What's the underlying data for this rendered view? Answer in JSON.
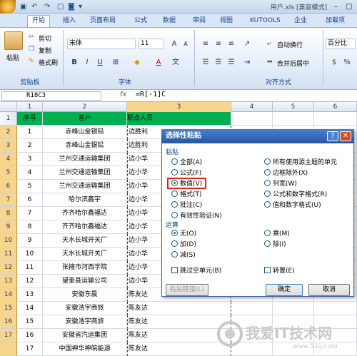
{
  "titlebar": {
    "title": "用户.xls [兼容模式]"
  },
  "tabs": [
    "开始",
    "插入",
    "页面布局",
    "公式",
    "数据",
    "审阅",
    "视图",
    "KUTOOLS",
    "企业",
    "加载项"
  ],
  "ribbon": {
    "paste_label": "粘贴",
    "cut_label": "剪切",
    "copy_label": "复制",
    "format_painter_label": "格式刷",
    "clipboard_label": "剪贴板",
    "font_name": "宋体",
    "font_size": "11",
    "font_group_label": "字体",
    "bold": "B",
    "italic": "I",
    "underline": "U",
    "wrap_text_label": "自动换行",
    "merge_label": "合并后居中",
    "align_group_label": "对齐方式",
    "number_format": "百分比"
  },
  "formula_bar": {
    "name_box": "R18C3",
    "fx": "fx",
    "formula": "=R[-1]C"
  },
  "grid": {
    "col_headers": [
      "1",
      "2",
      "3",
      "4",
      "5",
      "6"
    ],
    "row_headers": [
      "1",
      "2",
      "3",
      "4",
      "5",
      "6",
      "7",
      "8",
      "9",
      "10",
      "11",
      "12",
      "13",
      "14",
      "15",
      "16",
      "17"
    ],
    "header_row": [
      "序号",
      "客户",
      "联点人员"
    ],
    "rows": [
      [
        "1",
        "赤峰山金银铅",
        "边胜利"
      ],
      [
        "2",
        "赤峰山金银铅",
        "边胜利"
      ],
      [
        "3",
        "兰州交通运输集团",
        "边小华"
      ],
      [
        "4",
        "兰州交通运输集团",
        "边小华"
      ],
      [
        "5",
        "兰州交通运输集团",
        "边小华"
      ],
      [
        "6",
        "哈尔滨鑫宇",
        "边小华"
      ],
      [
        "7",
        "齐齐哈尔鑫福达",
        "边小华"
      ],
      [
        "8",
        "齐齐哈尔鑫福达",
        "边小华"
      ],
      [
        "9",
        "天水长城开关厂",
        "边小华"
      ],
      [
        "10",
        "天水长城开关厂",
        "边小华"
      ],
      [
        "11",
        "张掖市河西学院",
        "边小华"
      ],
      [
        "12",
        "望奎县运输公司",
        "边小华"
      ],
      [
        "13",
        "安徽东晨",
        "陈友达"
      ],
      [
        "14",
        "安徽浩宇商旅",
        "陈友达"
      ],
      [
        "15",
        "安徽浩宇商旅",
        "陈友达"
      ],
      [
        "16",
        "安徽省汽运集团",
        "陈友达"
      ],
      [
        "17",
        "中国神华神皖能源",
        "陈友达"
      ]
    ]
  },
  "dialog": {
    "title": "选择性粘贴",
    "help": "?",
    "close": "✕",
    "paste_section": "粘贴",
    "paste_left": [
      "全部(A)",
      "公式(F)",
      "数值(V)",
      "格式(T)",
      "批注(C)",
      "有效性验证(N)"
    ],
    "paste_right": [
      "所有使用源主题的单元",
      "边框除外(X)",
      "列宽(W)",
      "公式和数字格式(R)",
      "值和数字格式(U)"
    ],
    "operation_section": "运算",
    "op_left": [
      "无(O)",
      "加(D)",
      "减(S)"
    ],
    "op_right": [
      "乘(M)",
      "除(I)"
    ],
    "skip_blanks": "跳过空单元(B)",
    "transpose": "转置(E)",
    "paste_link": "粘贴链接(L)",
    "ok": "确定",
    "cancel": "取消"
  },
  "watermark": {
    "text": "我爱IT技术网",
    "url": "www.52ij.com"
  }
}
